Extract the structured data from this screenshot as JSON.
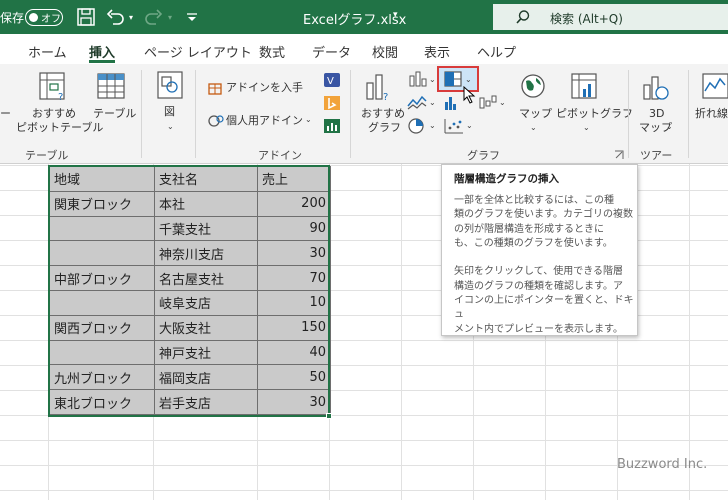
{
  "titlebar": {
    "autosave_label": "保存",
    "autosave_state": "オフ",
    "filename": "Excelグラフ.xlsx",
    "filename_caret": "▾",
    "search_placeholder": "検索 (Alt+Q)",
    "bg_color": "#217346"
  },
  "tabs": [
    {
      "label": "ホーム"
    },
    {
      "label": "挿入",
      "active": true
    },
    {
      "label": "ページ レイアウト"
    },
    {
      "label": "数式"
    },
    {
      "label": "データ"
    },
    {
      "label": "校閲"
    },
    {
      "label": "表示"
    },
    {
      "label": "ヘルプ"
    }
  ],
  "ribbon": {
    "tables_group": {
      "pivot_partial": "ー",
      "recommended_pivot": [
        "おすすめ",
        "ピボットテーブル"
      ],
      "table": "テーブル",
      "group_label": "テーブル"
    },
    "illustrations": {
      "label": "図"
    },
    "addins_group": {
      "get_addins": "アドインを入手",
      "personal_addins": "個人用アドイン",
      "group_label": "アドイン"
    },
    "charts_group": {
      "recommended_charts": [
        "おすすめ",
        "グラフ"
      ],
      "maps": "マップ",
      "pivot_chart": "ピボットグラフ",
      "group_label": "グラフ"
    },
    "tours_group": {
      "map3d": [
        "3D",
        "マップ"
      ],
      "group_label": "ツアー"
    },
    "sparklines": {
      "partial_label": "折れ線"
    }
  },
  "tooltip": {
    "title": "階層構造グラフの挿入",
    "body": "一部を全体と比較するには、この種\n類のグラフを使います。カテゴリの複数\nの列が階層構造を形成するときに\nも、この種類のグラフを使います。\n\n矢印をクリックして、使用できる階層\n構造のグラフの種類を確認します。ア\nイコンの上にポインターを置くと、ドキュ\nメント内でプレビューを表示します。"
  },
  "table": {
    "headers": [
      "地域",
      "支社名",
      "売上"
    ],
    "rows": [
      [
        "関東ブロック",
        "本社",
        "200"
      ],
      [
        "",
        "千葉支社",
        "90"
      ],
      [
        "",
        "神奈川支店",
        "30"
      ],
      [
        "中部ブロック",
        "名古屋支社",
        "70"
      ],
      [
        "",
        "岐阜支店",
        "10"
      ],
      [
        "関西ブロック",
        "大阪支社",
        "150"
      ],
      [
        "",
        "神戸支社",
        "40"
      ],
      [
        "九州ブロック",
        "福岡支店",
        "50"
      ],
      [
        "東北ブロック",
        "岩手支店",
        "30"
      ]
    ]
  },
  "watermark": "Buzzword Inc."
}
